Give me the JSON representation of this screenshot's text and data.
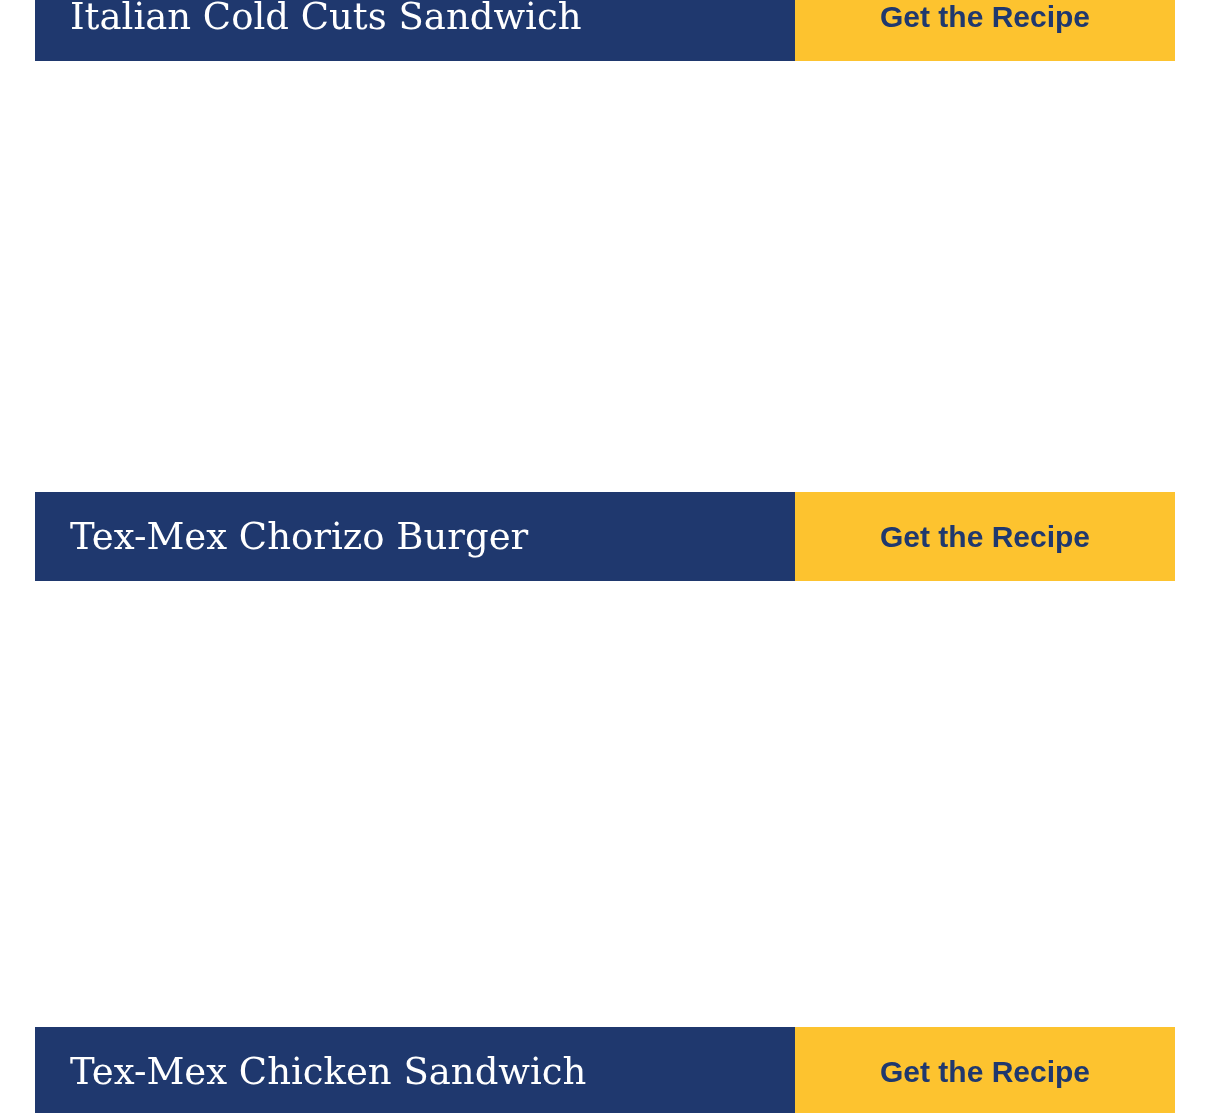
{
  "recipes": [
    {
      "title": "Italian Cold Cuts Sandwich",
      "button": "Get the Recipe"
    },
    {
      "title": "Tex-Mex Chorizo Burger",
      "button": "Get the Recipe"
    },
    {
      "title": "Tex-Mex Chicken Sandwich",
      "button": "Get the Recipe"
    }
  ]
}
